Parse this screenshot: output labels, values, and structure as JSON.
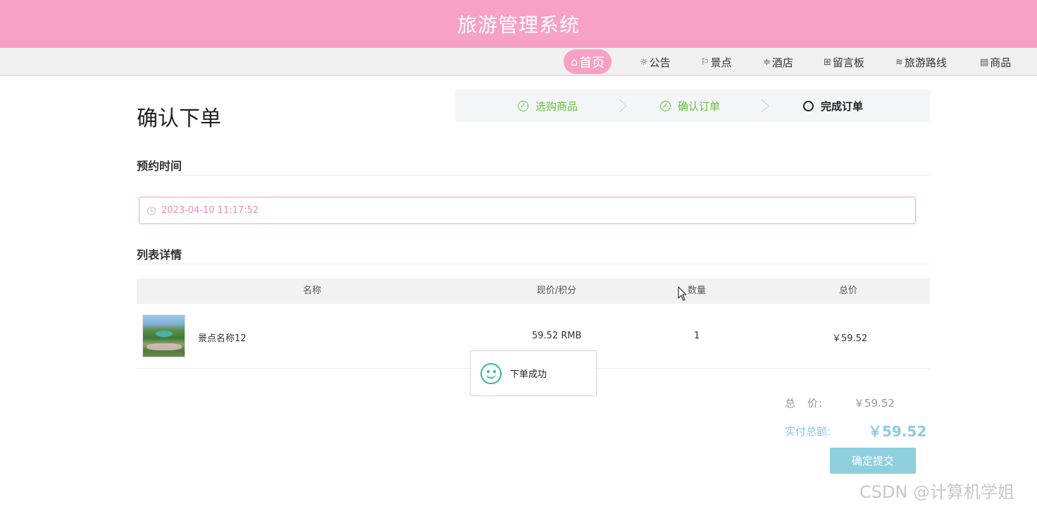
{
  "app": {
    "title": "旅游管理系统"
  },
  "nav": {
    "items": [
      {
        "label": "首页",
        "icon": "home-icon",
        "active": true
      },
      {
        "label": "公告",
        "icon": "sound-icon"
      },
      {
        "label": "景点",
        "icon": "flag-icon"
      },
      {
        "label": "酒店",
        "icon": "sliders-icon"
      },
      {
        "label": "留言板",
        "icon": "message-icon"
      },
      {
        "label": "旅游路线",
        "icon": "layers-icon"
      },
      {
        "label": "商品",
        "icon": "document-icon"
      }
    ]
  },
  "page": {
    "title": "确认下单"
  },
  "steps": [
    {
      "label": "选购商品",
      "status": "done"
    },
    {
      "label": "确认订单",
      "status": "done"
    },
    {
      "label": "完成订单",
      "status": "current"
    }
  ],
  "booking": {
    "section_title": "预约时间",
    "datetime_value": "2023-04-10 11:17:52"
  },
  "list": {
    "section_title": "列表详情",
    "columns": [
      "名称",
      "现价/积分",
      "数量",
      "总价"
    ],
    "rows": [
      {
        "name": "景点名称12",
        "price": "59.52 RMB",
        "quantity": "1",
        "total": "￥59.52"
      }
    ]
  },
  "toast": {
    "message": "下单成功"
  },
  "summary": {
    "total_label": "总　价:",
    "total_value": "￥59.52",
    "paid_label": "实付总额:",
    "paid_value": "￥59.52"
  },
  "actions": {
    "submit_label": "确定提交"
  },
  "watermark": "CSDN @计算机学姐",
  "colors": {
    "brand_pink": "#f7a1c4",
    "success_green": "#67c23a",
    "accent_blue": "#8ecfdf"
  }
}
